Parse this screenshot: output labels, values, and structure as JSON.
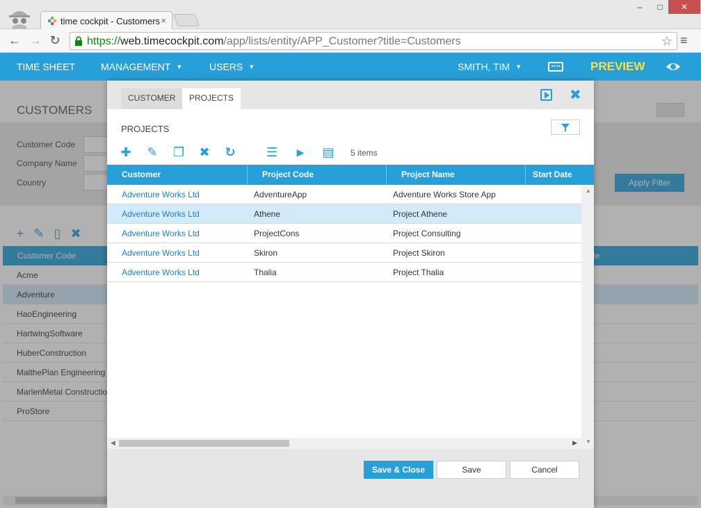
{
  "browser": {
    "tab_title": "time cockpit - Customers",
    "tab_close": "×",
    "url_protocol": "https://",
    "url_host": "web.timecockpit.com",
    "url_path": "/app/lists/entity/APP_Customer?title=Customers",
    "window_buttons": {
      "minimize": "–",
      "maximize": "□",
      "close": "✕"
    },
    "back": "←",
    "forward": "→",
    "reload": "↻",
    "star": "☆",
    "menu": "≡"
  },
  "appnav": {
    "time_sheet": "TIME SHEET",
    "management": "MANAGEMENT",
    "users": "USERS",
    "user_name": "SMITH, TIM",
    "preview": "PREVIEW",
    "caret": "▼"
  },
  "background_page": {
    "title": "CUSTOMERS",
    "filter_labels": [
      "Customer Code",
      "Company Name",
      "Country"
    ],
    "apply_filter": "Apply Filter",
    "toolbar": "+✎▯✖",
    "column_header": "Customer Code",
    "column_header_right": "de",
    "rows": [
      "Acme",
      "Adventure",
      "HaoEngineering",
      "HartwingSoftware",
      "HuberConstruction",
      "MalthePlan Engineering",
      "MarlenMetal Construction",
      "ProStore"
    ]
  },
  "dialog": {
    "tabs": [
      "CUSTOMER",
      "PROJECTS"
    ],
    "close": "✖",
    "heading": "PROJECTS",
    "toolbar": {
      "add": "✚",
      "edit": "✎",
      "copy": "❐",
      "delete": "✖",
      "refresh": "↻",
      "indent": "☰",
      "run": "▶",
      "doc": "▤"
    },
    "items_count": "5 items",
    "columns": [
      "Customer",
      "Project Code",
      "Project Name",
      "Start Date"
    ],
    "rows": [
      {
        "customer": "Adventure Works Ltd",
        "code": "AdventureApp",
        "name": "Adventure Works Store App"
      },
      {
        "customer": "Adventure Works Ltd",
        "code": "Athene",
        "name": "Project Athene"
      },
      {
        "customer": "Adventure Works Ltd",
        "code": "ProjectCons",
        "name": "Project Consulting"
      },
      {
        "customer": "Adventure Works Ltd",
        "code": "Skiron",
        "name": "Project Skiron"
      },
      {
        "customer": "Adventure Works Ltd",
        "code": "Thalia",
        "name": "Project Thalia"
      }
    ],
    "selected_row": 1,
    "scroll": {
      "up": "▲",
      "down": "▼",
      "left": "◀",
      "right": "▶"
    },
    "buttons": {
      "save_close": "Save & Close",
      "save": "Save",
      "cancel": "Cancel"
    }
  },
  "colors": {
    "accent": "#27a0d9",
    "preview": "#f5e04a",
    "link": "#1f7fc4",
    "selected_row": "#d3ebf8"
  }
}
